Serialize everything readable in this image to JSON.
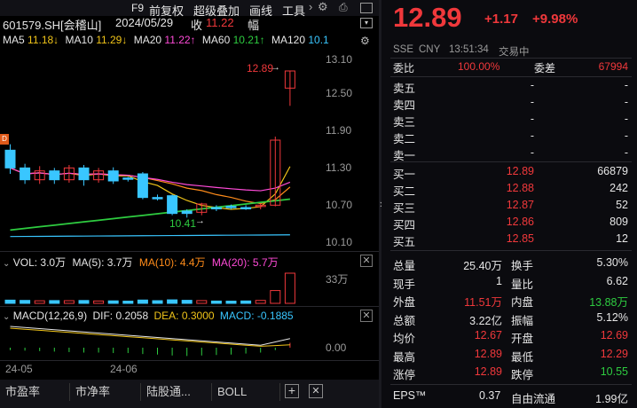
{
  "header": {
    "f9": "F9",
    "menus": [
      "前复权",
      "超级叠加",
      "画线",
      "工具"
    ],
    "symbol": "601579.SH[会稽山]",
    "date": "2024/05/29",
    "close_label": "收",
    "close_value": "11.22",
    "range_label": "幅"
  },
  "ma_legend": [
    {
      "label": "MA5",
      "value": "11.18↓",
      "color": "#f0c419"
    },
    {
      "label": "MA10",
      "value": "11.29↓",
      "color": "#f0c419"
    },
    {
      "label": "MA20",
      "value": "11.22↑",
      "color": "#ff4bd8"
    },
    {
      "label": "MA60",
      "value": "10.21↑",
      "color": "#2ecc40"
    },
    {
      "label": "MA120",
      "value": "10.1",
      "color": "#39c6ff"
    }
  ],
  "chart_data": {
    "type": "candlestick",
    "y_ticks": [
      "13.10",
      "12.50",
      "11.90",
      "11.30",
      "10.70",
      "10.10"
    ],
    "high_marker": "12.89",
    "low_marker": "10.41",
    "x_labels": [
      "24-05",
      "24-06"
    ],
    "candles": [
      {
        "o": 11.55,
        "c": 11.25,
        "h": 11.65,
        "l": 11.15
      },
      {
        "o": 11.25,
        "c": 11.05,
        "h": 11.32,
        "l": 10.98
      },
      {
        "o": 11.05,
        "c": 11.2,
        "h": 11.28,
        "l": 10.98
      },
      {
        "o": 11.2,
        "c": 11.05,
        "h": 11.25,
        "l": 10.98
      },
      {
        "o": 11.05,
        "c": 11.25,
        "h": 11.3,
        "l": 11.0
      },
      {
        "o": 11.25,
        "c": 11.05,
        "h": 11.3,
        "l": 10.95
      },
      {
        "o": 11.05,
        "c": 11.2,
        "h": 11.25,
        "l": 11.0
      },
      {
        "o": 11.2,
        "c": 11.03,
        "h": 11.26,
        "l": 10.98
      },
      {
        "o": 11.08,
        "c": 11.06,
        "h": 11.1,
        "l": 11.02
      },
      {
        "o": 11.15,
        "c": 10.75,
        "h": 11.18,
        "l": 10.72
      },
      {
        "o": 10.75,
        "c": 10.73,
        "h": 10.8,
        "l": 10.7
      },
      {
        "o": 10.78,
        "c": 10.48,
        "h": 10.8,
        "l": 10.45
      },
      {
        "o": 10.52,
        "c": 10.48,
        "h": 10.55,
        "l": 10.41
      },
      {
        "o": 10.5,
        "c": 10.64,
        "h": 10.66,
        "l": 10.45
      },
      {
        "o": 10.58,
        "c": 10.57,
        "h": 10.62,
        "l": 10.52
      },
      {
        "o": 10.6,
        "c": 10.58,
        "h": 10.63,
        "l": 10.55
      },
      {
        "o": 10.58,
        "c": 10.56,
        "h": 10.62,
        "l": 10.54
      },
      {
        "o": 10.6,
        "c": 10.62,
        "h": 10.65,
        "l": 10.55
      },
      {
        "o": 10.62,
        "c": 11.72,
        "h": 11.78,
        "l": 10.6
      },
      {
        "o": 12.6,
        "c": 12.89,
        "h": 12.89,
        "l": 12.3
      }
    ],
    "volume_legend": {
      "vol": "VOL: 3.0万",
      "ma5": "MA(5): 3.7万",
      "ma10": "MA(10): 4.4万",
      "ma20": "MA(20): 5.7万"
    },
    "volume_tick": "33万",
    "volumes": [
      3.5,
      3.2,
      2.8,
      3.0,
      2.9,
      3.1,
      2.6,
      2.7,
      2.4,
      3.6,
      2.9,
      3.8,
      3.3,
      3.0,
      2.5,
      2.4,
      2.6,
      3.2,
      14.0,
      33.0
    ],
    "macd_legend": {
      "title": "MACD(12,26,9)",
      "dif": "DIF: 0.2058",
      "dea": "DEA: 0.3000",
      "macd": "MACD: -0.1885"
    },
    "macd_tick": "0.00",
    "macd_bars": [
      -0.05,
      -0.06,
      -0.07,
      -0.08,
      -0.09,
      -0.1,
      -0.1,
      -0.11,
      -0.11,
      -0.13,
      -0.14,
      -0.16,
      -0.17,
      -0.16,
      -0.15,
      -0.14,
      -0.12,
      -0.1,
      -0.05,
      0.1
    ]
  },
  "bottom_tabs": [
    "市盈率",
    "市净率",
    "陆股通...",
    "BOLL"
  ],
  "quote": {
    "price": "12.89",
    "change": "+1.17",
    "change_pct": "+9.98%",
    "exchange": "SSE",
    "currency": "CNY",
    "time": "13:51:34",
    "status": "交易中",
    "weibi_label": "委比",
    "weibi_value": "100.00%",
    "weicha_label": "委差",
    "weicha_value": "67994",
    "asks": [
      {
        "label": "卖五",
        "price": "-",
        "vol": "-"
      },
      {
        "label": "卖四",
        "price": "-",
        "vol": "-"
      },
      {
        "label": "卖三",
        "price": "-",
        "vol": "-"
      },
      {
        "label": "卖二",
        "price": "-",
        "vol": "-"
      },
      {
        "label": "卖一",
        "price": "-",
        "vol": "-"
      }
    ],
    "bids": [
      {
        "label": "买一",
        "price": "12.89",
        "vol": "66879"
      },
      {
        "label": "买二",
        "price": "12.88",
        "vol": "242"
      },
      {
        "label": "买三",
        "price": "12.87",
        "vol": "52"
      },
      {
        "label": "买四",
        "price": "12.86",
        "vol": "809"
      },
      {
        "label": "买五",
        "price": "12.85",
        "vol": "12"
      }
    ],
    "stats": [
      {
        "l1": "总量",
        "v1": "25.40万",
        "c1": "white",
        "l2": "换手",
        "v2": "5.30%",
        "c2": "white"
      },
      {
        "l1": "现手",
        "v1": "1",
        "c1": "white",
        "l2": "量比",
        "v2": "6.62",
        "c2": "white"
      },
      {
        "l1": "外盘",
        "v1": "11.51万",
        "c1": "red",
        "l2": "内盘",
        "v2": "13.88万",
        "c2": "green"
      },
      {
        "l1": "总额",
        "v1": "3.22亿",
        "c1": "white",
        "l2": "振幅",
        "v2": "5.12%",
        "c2": "white"
      },
      {
        "l1": "均价",
        "v1": "12.67",
        "c1": "red",
        "l2": "开盘",
        "v2": "12.69",
        "c2": "red"
      },
      {
        "l1": "最高",
        "v1": "12.89",
        "c1": "red",
        "l2": "最低",
        "v2": "12.29",
        "c2": "red"
      },
      {
        "l1": "涨停",
        "v1": "12.89",
        "c1": "red",
        "l2": "跌停",
        "v2": "10.55",
        "c2": "green"
      }
    ],
    "eps_label": "EPS™",
    "eps_value": "0.37",
    "float_label": "自由流通",
    "float_value": "1.99亿"
  }
}
